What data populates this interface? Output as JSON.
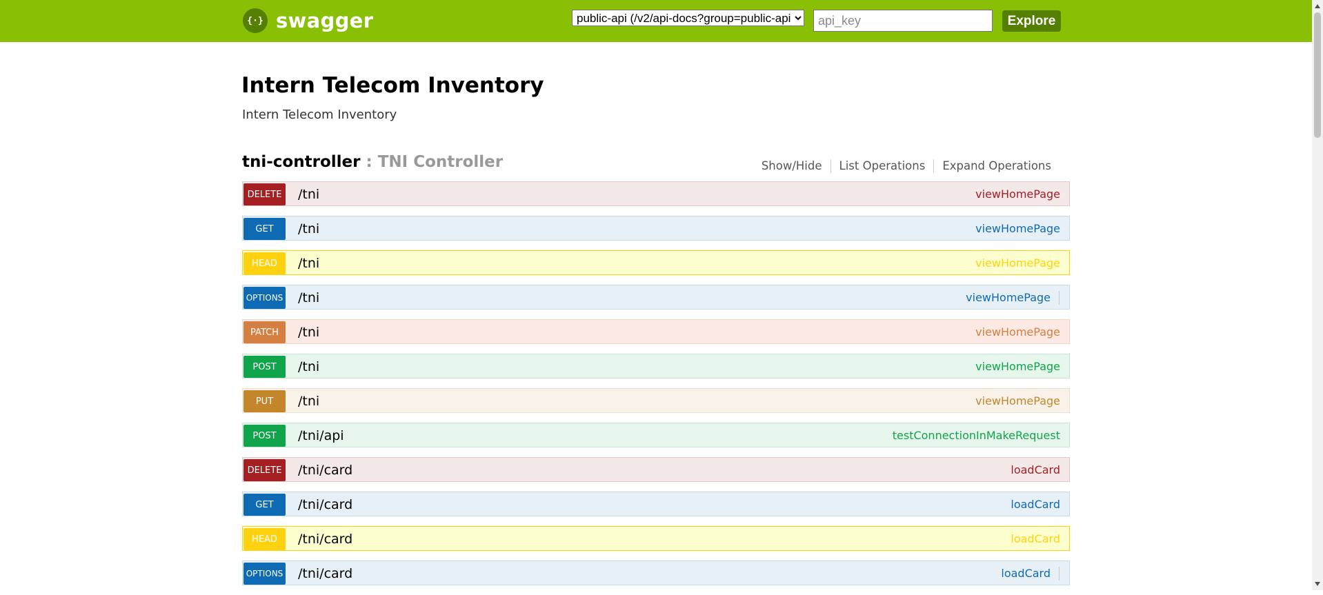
{
  "header": {
    "logo_text": "swagger",
    "logo_icon": "swagger-braces-icon",
    "api_select": {
      "selected": "public-api (/v2/api-docs?group=public-api)",
      "options": [
        "public-api (/v2/api-docs?group=public-api)"
      ]
    },
    "api_key_placeholder": "api_key",
    "explore_label": "Explore",
    "colors": {
      "bar": "#89bf04",
      "button": "#547f00"
    }
  },
  "info": {
    "title": "Intern Telecom Inventory",
    "description": "Intern Telecom Inventory"
  },
  "resource": {
    "name": "tni-controller",
    "description": ": TNI Controller",
    "links": {
      "show_hide": "Show/Hide",
      "list_operations": "List Operations",
      "expand_operations": "Expand Operations"
    }
  },
  "operations": [
    {
      "method": "DELETE",
      "path": "/tni",
      "nickname": "viewHomePage"
    },
    {
      "method": "GET",
      "path": "/tni",
      "nickname": "viewHomePage"
    },
    {
      "method": "HEAD",
      "path": "/tni",
      "nickname": "viewHomePage"
    },
    {
      "method": "OPTIONS",
      "path": "/tni",
      "nickname": "viewHomePage"
    },
    {
      "method": "PATCH",
      "path": "/tni",
      "nickname": "viewHomePage"
    },
    {
      "method": "POST",
      "path": "/tni",
      "nickname": "viewHomePage"
    },
    {
      "method": "PUT",
      "path": "/tni",
      "nickname": "viewHomePage"
    },
    {
      "method": "POST",
      "path": "/tni/api",
      "nickname": "testConnectionInMakeRequest"
    },
    {
      "method": "DELETE",
      "path": "/tni/card",
      "nickname": "loadCard"
    },
    {
      "method": "GET",
      "path": "/tni/card",
      "nickname": "loadCard"
    },
    {
      "method": "HEAD",
      "path": "/tni/card",
      "nickname": "loadCard"
    },
    {
      "method": "OPTIONS",
      "path": "/tni/card",
      "nickname": "loadCard"
    }
  ],
  "method_colors": {
    "DELETE": {
      "badge": "#a41e22",
      "bg": "#f5e8e8",
      "border": "#e8c6c7",
      "text": "#a41e22"
    },
    "GET": {
      "badge": "#0f6ab4",
      "bg": "#e7f0f7",
      "border": "#c3d9ec",
      "text": "#0f6ab4"
    },
    "HEAD": {
      "badge": "#ffd20f",
      "bg": "#fcffcd",
      "border": "#ffd20f",
      "text": "#ffd20f"
    },
    "OPTIONS": {
      "badge": "#0f6ab4",
      "bg": "#e7f0f7",
      "border": "#c3d9ec",
      "text": "#0f6ab4"
    },
    "PATCH": {
      "badge": "#d38042",
      "bg": "#fce9e3",
      "border": "#f5d5c3",
      "text": "#d38042"
    },
    "POST": {
      "badge": "#10a54a",
      "bg": "#e7f6ec",
      "border": "#c3e8d1",
      "text": "#10a54a"
    },
    "PUT": {
      "badge": "#c5862b",
      "bg": "#f9f2e9",
      "border": "#f0e0ca",
      "text": "#c5862b"
    }
  }
}
